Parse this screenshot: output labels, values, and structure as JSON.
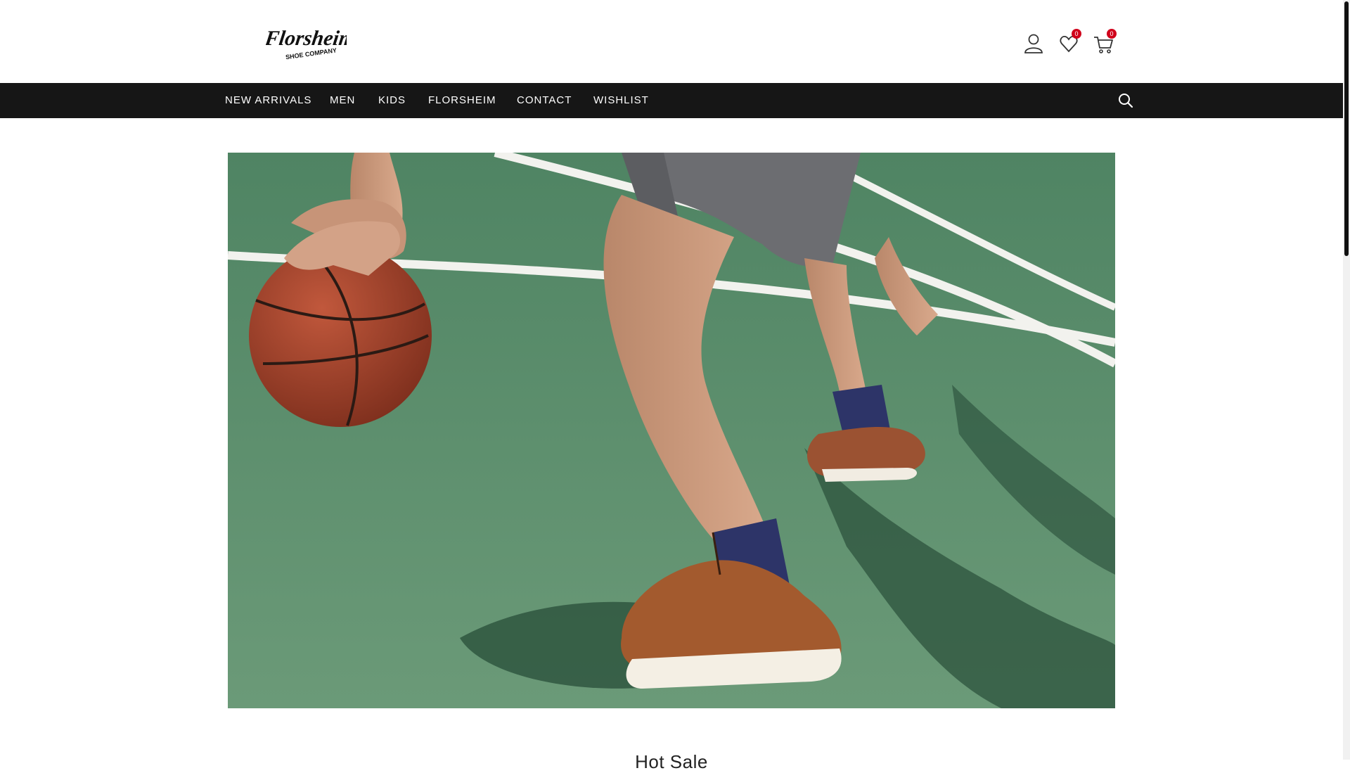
{
  "brand": {
    "logo_text": "Florsheim",
    "logo_subtext": "SHOE COMPANY"
  },
  "header": {
    "account_icon": "user-icon",
    "wishlist_icon": "heart-icon",
    "wishlist_count": "0",
    "cart_icon": "cart-icon",
    "cart_count": "0",
    "badge_color": "#d0021b"
  },
  "nav": {
    "background": "#161616",
    "items": [
      {
        "label": "NEW ARRIVALS"
      },
      {
        "label": "MEN"
      },
      {
        "label": "KIDS"
      },
      {
        "label": "FLORSHEIM"
      },
      {
        "label": "CONTACT"
      },
      {
        "label": "WISHLIST"
      }
    ],
    "search_icon": "search-icon"
  },
  "hero": {
    "image": "basketball-court-sneaker-photo"
  },
  "section": {
    "heading": "Hot Sale"
  }
}
